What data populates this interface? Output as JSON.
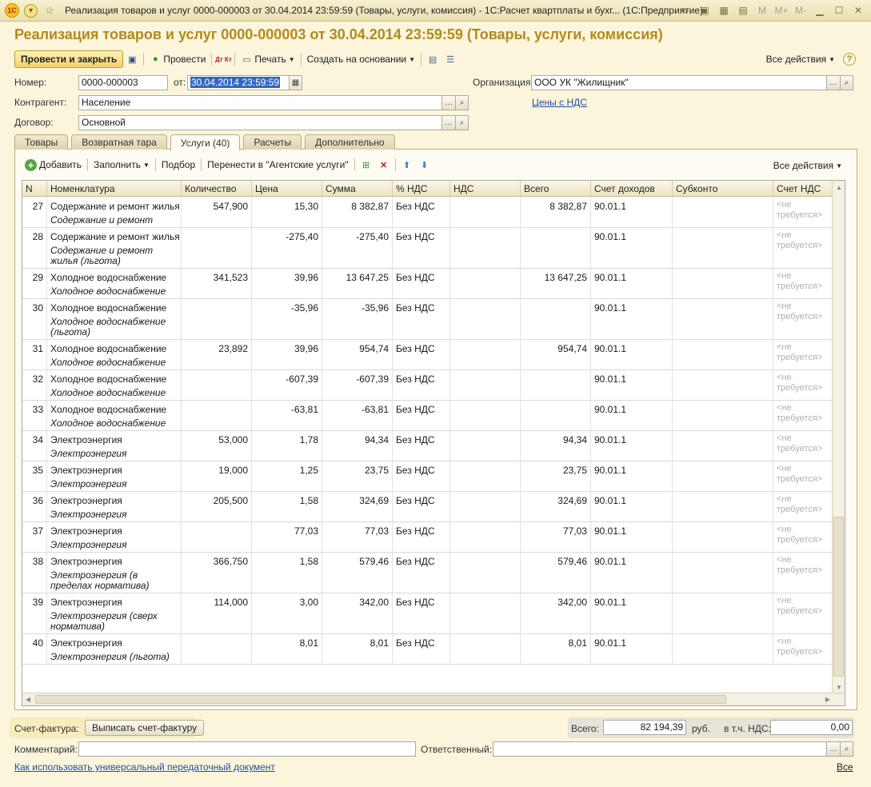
{
  "window": {
    "title": "Реализация товаров и услуг 0000-000003 от 30.04.2014 23:59:59 (Товары, услуги, комиссия) - 1С:Расчет квартплаты и бухг...  (1С:Предприятие)",
    "logo_text": "1С",
    "m_labels": [
      "M",
      "M+",
      "M-"
    ]
  },
  "doc_title": "Реализация товаров и услуг 0000-000003 от 30.04.2014 23:59:59 (Товары, услуги, комиссия)",
  "toolbar": {
    "post_close": "Провести и закрыть",
    "post": "Провести",
    "dtkt": "Дт Кт",
    "print": "Печать",
    "create_based": "Создать на основании",
    "all_actions": "Все действия",
    "help": "?"
  },
  "form": {
    "number_label": "Номер:",
    "number_value": "0000-000003",
    "from_label": "от:",
    "date_value": "30.04.2014 23:59:59",
    "org_label": "Организация:",
    "org_value": "ООО УК \"Жилищник\"",
    "contractor_label": "Контрагент:",
    "contractor_value": "Население",
    "prices_link": "Цены с НДС",
    "contract_label": "Договор:",
    "contract_value": "Основной"
  },
  "tabs": [
    "Товары",
    "Возвратная тара",
    "Услуги (40)",
    "Расчеты",
    "Дополнительно"
  ],
  "inner_toolbar": {
    "add": "Добавить",
    "fill": "Заполнить",
    "select": "Подбор",
    "move": "Перенести в \"Агентские услуги\"",
    "all_actions": "Все действия"
  },
  "table": {
    "columns": [
      "N",
      "Номенклатура",
      "Количество",
      "Цена",
      "Сумма",
      "% НДС",
      "НДС",
      "Всего",
      "Счет доходов",
      "Субконто",
      "Счет НДС"
    ],
    "rows": [
      {
        "n": "27",
        "name": "Содержание и ремонт жилья",
        "sub": "Содержание и ремонт жилья",
        "qty": "547,900",
        "price": "15,30",
        "sum": "8 382,87",
        "vat_rate": "Без НДС",
        "vat": "",
        "total": "8 382,87",
        "acc": "90.01.1",
        "subconto": "",
        "vat_acc": "<не требуется>"
      },
      {
        "n": "28",
        "name": "Содержание и ремонт жилья",
        "sub": "Содержание и ремонт жилья (льгота)",
        "qty": "",
        "price": "-275,40",
        "sum": "-275,40",
        "vat_rate": "Без НДС",
        "vat": "",
        "total": "",
        "acc": "90.01.1",
        "subconto": "",
        "vat_acc": "<не требуется>"
      },
      {
        "n": "29",
        "name": "Холодное водоснабжение",
        "sub": "Холодное водоснабжение",
        "qty": "341,523",
        "price": "39,96",
        "sum": "13 647,25",
        "vat_rate": "Без НДС",
        "vat": "",
        "total": "13 647,25",
        "acc": "90.01.1",
        "subconto": "",
        "vat_acc": "<не требуется>"
      },
      {
        "n": "30",
        "name": "Холодное водоснабжение",
        "sub": "Холодное водоснабжение (льгота)",
        "qty": "",
        "price": "-35,96",
        "sum": "-35,96",
        "vat_rate": "Без НДС",
        "vat": "",
        "total": "",
        "acc": "90.01.1",
        "subconto": "",
        "vat_acc": "<не требуется>"
      },
      {
        "n": "31",
        "name": "Холодное водоснабжение",
        "sub": "Холодное водоснабжение",
        "qty": "23,892",
        "price": "39,96",
        "sum": "954,74",
        "vat_rate": "Без НДС",
        "vat": "",
        "total": "954,74",
        "acc": "90.01.1",
        "subconto": "",
        "vat_acc": "<не требуется>"
      },
      {
        "n": "32",
        "name": "Холодное водоснабжение",
        "sub": "Холодное водоснабжение",
        "qty": "",
        "price": "-607,39",
        "sum": "-607,39",
        "vat_rate": "Без НДС",
        "vat": "",
        "total": "",
        "acc": "90.01.1",
        "subconto": "",
        "vat_acc": "<не требуется>"
      },
      {
        "n": "33",
        "name": "Холодное водоснабжение",
        "sub": "Холодное водоснабжение",
        "qty": "",
        "price": "-63,81",
        "sum": "-63,81",
        "vat_rate": "Без НДС",
        "vat": "",
        "total": "",
        "acc": "90.01.1",
        "subconto": "",
        "vat_acc": "<не требуется>"
      },
      {
        "n": "34",
        "name": "Электроэнергия",
        "sub": "Электроэнергия",
        "qty": "53,000",
        "price": "1,78",
        "sum": "94,34",
        "vat_rate": "Без НДС",
        "vat": "",
        "total": "94,34",
        "acc": "90.01.1",
        "subconto": "",
        "vat_acc": "<не требуется>"
      },
      {
        "n": "35",
        "name": "Электроэнергия",
        "sub": "Электроэнергия",
        "qty": "19,000",
        "price": "1,25",
        "sum": "23,75",
        "vat_rate": "Без НДС",
        "vat": "",
        "total": "23,75",
        "acc": "90.01.1",
        "subconto": "",
        "vat_acc": "<не требуется>"
      },
      {
        "n": "36",
        "name": "Электроэнергия",
        "sub": "Электроэнергия",
        "qty": "205,500",
        "price": "1,58",
        "sum": "324,69",
        "vat_rate": "Без НДС",
        "vat": "",
        "total": "324,69",
        "acc": "90.01.1",
        "subconto": "",
        "vat_acc": "<не требуется>"
      },
      {
        "n": "37",
        "name": "Электроэнергия",
        "sub": "Электроэнергия",
        "qty": "",
        "price": "77,03",
        "sum": "77,03",
        "vat_rate": "Без НДС",
        "vat": "",
        "total": "77,03",
        "acc": "90.01.1",
        "subconto": "",
        "vat_acc": "<не требуется>"
      },
      {
        "n": "38",
        "name": "Электроэнергия",
        "sub": "Электроэнергия (в пределах норматива)",
        "qty": "366,750",
        "price": "1,58",
        "sum": "579,46",
        "vat_rate": "Без НДС",
        "vat": "",
        "total": "579,46",
        "acc": "90.01.1",
        "subconto": "",
        "vat_acc": "<не требуется>"
      },
      {
        "n": "39",
        "name": "Электроэнергия",
        "sub": "Электроэнергия (сверх норматива)",
        "qty": "114,000",
        "price": "3,00",
        "sum": "342,00",
        "vat_rate": "Без НДС",
        "vat": "",
        "total": "342,00",
        "acc": "90.01.1",
        "subconto": "",
        "vat_acc": "<не требуется>"
      },
      {
        "n": "40",
        "name": "Электроэнергия",
        "sub": "Электроэнергия (льгота)",
        "qty": "",
        "price": "8,01",
        "sum": "8,01",
        "vat_rate": "Без НДС",
        "vat": "",
        "total": "8,01",
        "acc": "90.01.1",
        "subconto": "",
        "vat_acc": "<не требуется>"
      }
    ]
  },
  "footer": {
    "invoice_label": "Счет-фактура:",
    "invoice_button": "Выписать счет-фактуру",
    "total_label": "Всего:",
    "total_value": "82 194,39",
    "currency": "руб.",
    "vat_label": "в т.ч. НДС:",
    "vat_value": "0,00",
    "comment_label": "Комментарий:",
    "comment_value": "",
    "responsible_label": "Ответственный:",
    "responsible_value": "",
    "usage_link": "Как использовать универсальный передаточный документ",
    "all_link": "Все"
  }
}
